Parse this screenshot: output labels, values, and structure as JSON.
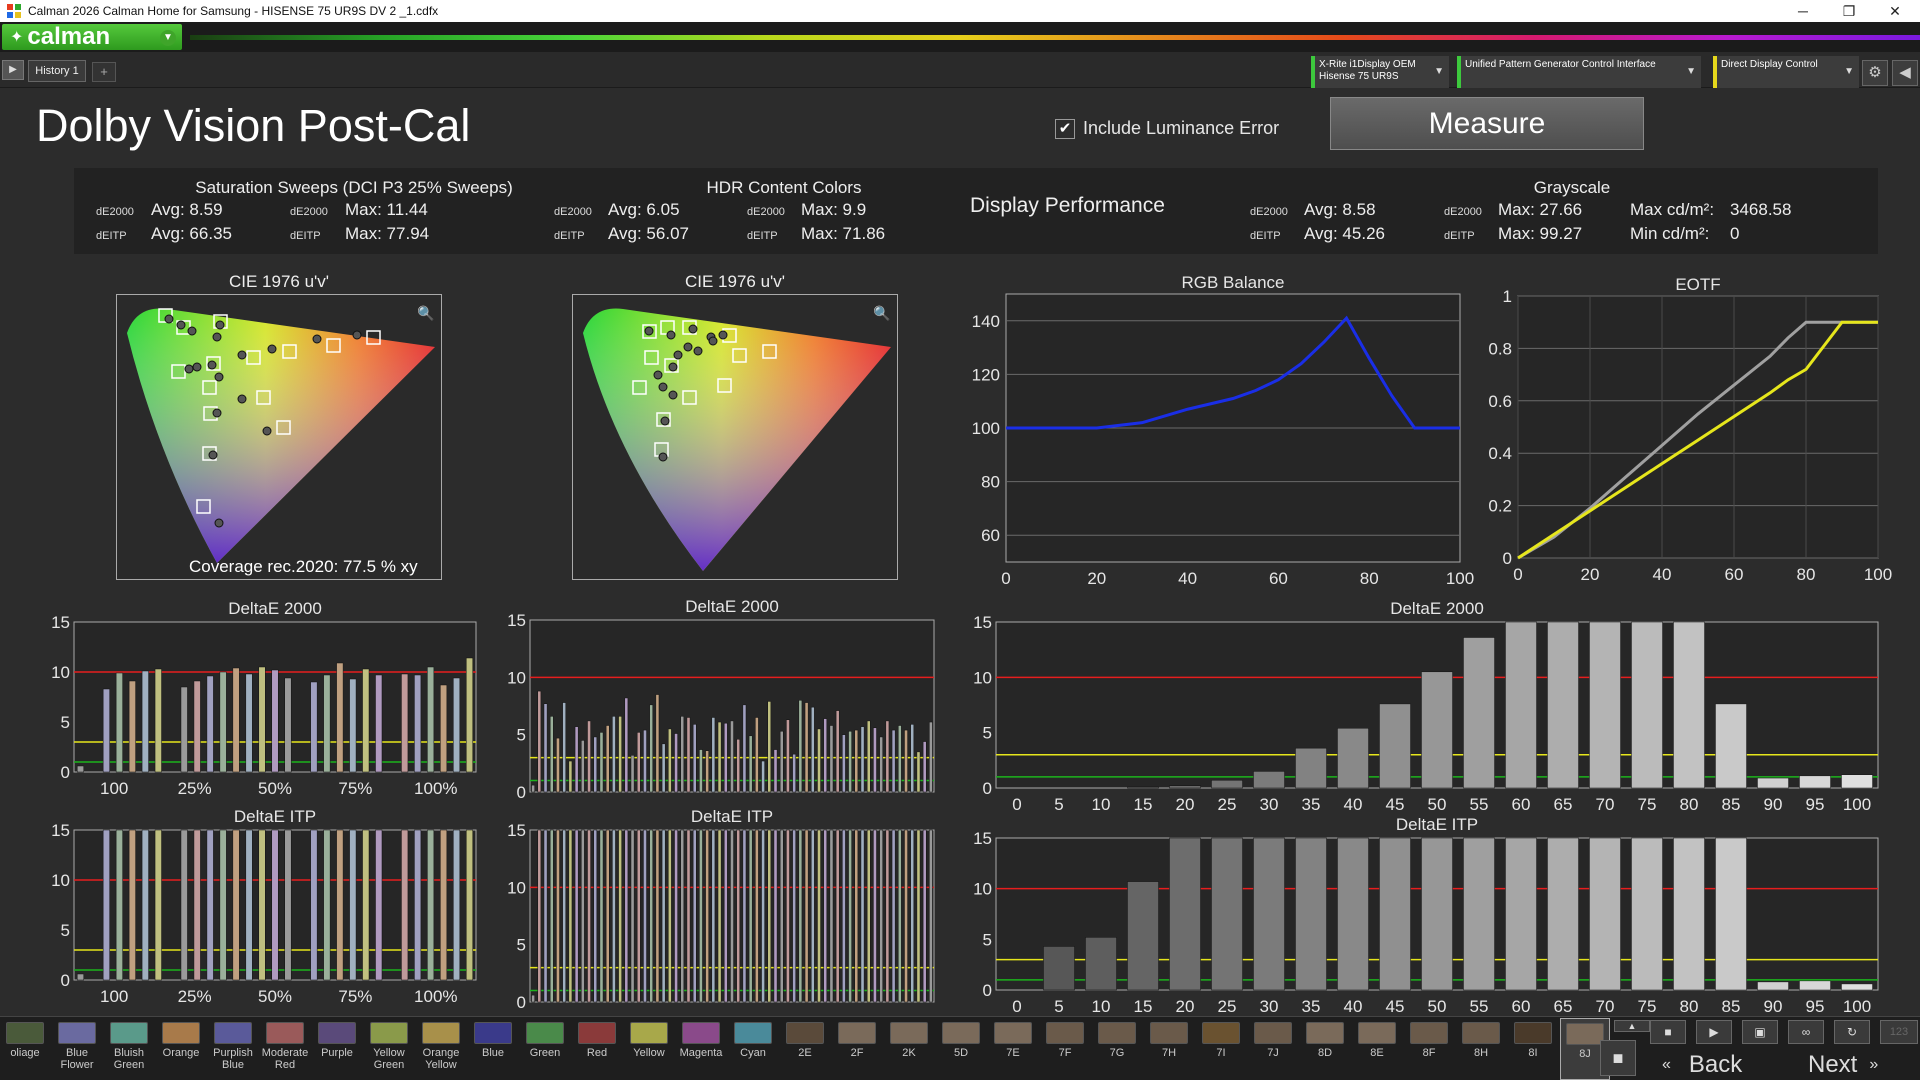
{
  "window": {
    "title": "Calman 2026 Calman Home for Samsung  - HISENSE 75 UR9S DV 2 _1.cdfx",
    "minimize": "─",
    "maximize": "❐",
    "close": "✕"
  },
  "logo": {
    "text": "calman"
  },
  "tabs": [
    {
      "label": "History 1"
    }
  ],
  "tab_add": "+",
  "devices": [
    {
      "line1": "X-Rite i1Display OEM",
      "line2": "Hisense 75 UR9S"
    },
    {
      "line1": "Unified Pattern Generator Control Interface",
      "line2": ""
    },
    {
      "line1": "Direct Display Control",
      "line2": ""
    }
  ],
  "page": {
    "title": "Dolby Vision Post-Cal"
  },
  "include_luminance": {
    "label": "Include Luminance Error",
    "checked": true
  },
  "measure_label": "Measure",
  "performance": {
    "heading": "Display Performance",
    "saturation": {
      "title": "Saturation Sweeps (DCI P3 25% Sweeps)",
      "de2000_avg": "Avg: 8.59",
      "de2000_max": "Max: 11.44",
      "deitp_avg": "Avg: 66.35",
      "deitp_max": "Max: 77.94"
    },
    "hdr": {
      "title": "HDR Content Colors",
      "de2000_avg": "Avg: 6.05",
      "de2000_max": "Max: 9.9",
      "deitp_avg": "Avg: 56.07",
      "deitp_max": "Max: 71.86"
    },
    "grayscale": {
      "title": "Grayscale",
      "de2000_avg": "Avg: 8.58",
      "de2000_max": "Max: 27.66",
      "deitp_avg": "Avg: 45.26",
      "deitp_max": "Max: 99.27",
      "max_cd": "Max cd/m²:",
      "max_cd_val": "3468.58",
      "min_cd": "Min cd/m²:",
      "min_cd_val": "0"
    },
    "label_de2000": "dE2000",
    "label_deitp": "dEITP"
  },
  "cie": {
    "title": "CIE 1976 u'v'",
    "coverage": "Coverage rec.2020:  77.5 % xy"
  },
  "chart_data": [
    {
      "type": "line",
      "title": "RGB Balance",
      "x": [
        0,
        10,
        20,
        30,
        40,
        50,
        55,
        60,
        65,
        70,
        75,
        80,
        85,
        90,
        95,
        100
      ],
      "series": [
        {
          "values": [
            100,
            100,
            100,
            102,
            107,
            111,
            114,
            118,
            124,
            132,
            141,
            126,
            112,
            100,
            100,
            100
          ],
          "color": "#1a2ee6"
        }
      ],
      "xticks": [
        "0",
        "20",
        "40",
        "60",
        "80",
        "100"
      ],
      "yticks": [
        "60",
        "80",
        "100",
        "120",
        "140"
      ],
      "xlim": [
        0,
        100
      ],
      "ylim": [
        50,
        150
      ]
    },
    {
      "type": "line",
      "title": "EOTF",
      "x": [
        0,
        0.1,
        0.2,
        0.3,
        0.4,
        0.5,
        0.6,
        0.7,
        0.75,
        0.8,
        0.9,
        1.0
      ],
      "series": [
        {
          "values": [
            0,
            0.08,
            0.19,
            0.31,
            0.43,
            0.55,
            0.66,
            0.77,
            0.84,
            0.9,
            0.9,
            0.9
          ],
          "color": "#a0a0a0"
        },
        {
          "values": [
            0,
            0.09,
            0.18,
            0.27,
            0.36,
            0.45,
            0.54,
            0.63,
            0.68,
            0.72,
            0.9,
            0.9
          ],
          "color": "#e6e61c"
        }
      ],
      "xticks": [
        "0",
        "20",
        "40",
        "60",
        "80",
        "100"
      ],
      "yticks": [
        "0",
        "0.2",
        "0.4",
        "0.6",
        "0.8",
        "1"
      ],
      "xlim": [
        0,
        100
      ],
      "ylim": [
        0,
        1
      ]
    },
    {
      "type": "bar",
      "title": "DeltaE 2000",
      "categories": [
        "100",
        "25%",
        "50%",
        "75%",
        "100%"
      ],
      "values": [
        0.6,
        0.0,
        8.3,
        9.9,
        9.1,
        10.1,
        10.3,
        0,
        8.5,
        9.1,
        9.6,
        10.0,
        10.4,
        9.8,
        10.5,
        10.2,
        9.4,
        0,
        9.0,
        9.7,
        10.9,
        9.3,
        10.3,
        9.7,
        0,
        9.8,
        9.7,
        10.5,
        8.7,
        9.4,
        11.4
      ],
      "ylim": [
        0,
        15
      ],
      "yticks": [
        "0",
        "5",
        "10",
        "15"
      ]
    },
    {
      "type": "bar",
      "title": "DeltaE 2000",
      "values": [
        0.6,
        8.8,
        7.7,
        6.6,
        4.7,
        7.8,
        2.7,
        5.7,
        4.5,
        6.2,
        4.8,
        5.2,
        5.8,
        6.6,
        6.6,
        8.2,
        3.2,
        5.2,
        5.4,
        7.6,
        8.5,
        4.2,
        5.5,
        5.1,
        6.6,
        6.5,
        5.9,
        3.7,
        3.6,
        6.5,
        6.1,
        6.0,
        6.2,
        4.6,
        7.6,
        4.9,
        6.5,
        2.7,
        7.9,
        3.7,
        5.3,
        6.3,
        3.3,
        8.0,
        7.8,
        7.4,
        5.5,
        6.4,
        5.8,
        7.1,
        5.0,
        5.3,
        5.4,
        5.7,
        6.2,
        5.6,
        4.8,
        6.2,
        5.4,
        5.8,
        5.4,
        5.9,
        3.5,
        4.4,
        6.1
      ],
      "ylim": [
        0,
        15
      ],
      "yticks": [
        "0",
        "5",
        "10",
        "15"
      ]
    },
    {
      "type": "bar",
      "title": "DeltaE 2000",
      "categories": [
        "0",
        "5",
        "10",
        "15",
        "20",
        "25",
        "30",
        "35",
        "40",
        "45",
        "50",
        "55",
        "60",
        "65",
        "70",
        "75",
        "80",
        "85",
        "90",
        "95",
        "100"
      ],
      "values": [
        0,
        0,
        0,
        0.1,
        0.2,
        0.7,
        1.5,
        3.6,
        5.4,
        7.6,
        10.5,
        13.6,
        27.66,
        22,
        20,
        18,
        16,
        7.6,
        0.9,
        1.1,
        1.2
      ],
      "ylim": [
        0,
        15
      ],
      "yticks": [
        "0",
        "5",
        "10",
        "15"
      ]
    },
    {
      "type": "bar",
      "title": "DeltaE ITP",
      "categories": [
        "100",
        "25%",
        "50%",
        "75%",
        "100%"
      ],
      "values": [
        0.6,
        0,
        60,
        62,
        64,
        66,
        68,
        0,
        60,
        62,
        65,
        66,
        68,
        70,
        72,
        64,
        60,
        0,
        62,
        66,
        70,
        72,
        74,
        66,
        0,
        62,
        64,
        70,
        74,
        72,
        77.94
      ],
      "ylim": [
        0,
        15
      ],
      "yticks": [
        "0",
        "5",
        "10",
        "15"
      ]
    },
    {
      "type": "bar",
      "title": "DeltaE ITP",
      "values": [
        0.6,
        56,
        56,
        56,
        56,
        56,
        56,
        56,
        56,
        56,
        56,
        56,
        56,
        56,
        56,
        56,
        56,
        56,
        56,
        56,
        56,
        56,
        56,
        56,
        56,
        56,
        56,
        56,
        56,
        56,
        56,
        56,
        56,
        56,
        56,
        56,
        56,
        56,
        56,
        56,
        56,
        56,
        56,
        56,
        56,
        56,
        56,
        56,
        56,
        56,
        56,
        56,
        56,
        56,
        56,
        56,
        56,
        56,
        56,
        56,
        56,
        56,
        56,
        56,
        56
      ],
      "ylim": [
        0,
        15
      ],
      "yticks": [
        "0",
        "5",
        "10",
        "15"
      ]
    },
    {
      "type": "bar",
      "title": "DeltaE ITP",
      "categories": [
        "0",
        "5",
        "10",
        "15",
        "20",
        "25",
        "30",
        "35",
        "40",
        "45",
        "50",
        "55",
        "60",
        "65",
        "70",
        "75",
        "80",
        "85",
        "90",
        "95",
        "100"
      ],
      "values": [
        0,
        4.3,
        5.2,
        10.7,
        30,
        40,
        50,
        60,
        70,
        80,
        90,
        95,
        99.27,
        95,
        90,
        85,
        80,
        80,
        0.8,
        0.9,
        0.6
      ],
      "ylim": [
        0,
        15
      ],
      "yticks": [
        "0",
        "5",
        "10",
        "15"
      ]
    }
  ],
  "swatches": [
    {
      "label": "oliage",
      "color": "#4a5a3a"
    },
    {
      "label": "Blue Flower",
      "color": "#6a6aa0"
    },
    {
      "label": "Bluish Green",
      "color": "#5a9a8a"
    },
    {
      "label": "Orange",
      "color": "#a87a4a"
    },
    {
      "label": "Purplish Blue",
      "color": "#5a5a9a"
    },
    {
      "label": "Moderate Red",
      "color": "#9a5a5a"
    },
    {
      "label": "Purple",
      "color": "#5a4a7a"
    },
    {
      "label": "Yellow Green",
      "color": "#8a9a4a"
    },
    {
      "label": "Orange Yellow",
      "color": "#a8904a"
    },
    {
      "label": "Blue",
      "color": "#3a3a8a"
    },
    {
      "label": "Green",
      "color": "#4a8a4a"
    },
    {
      "label": "Red",
      "color": "#8a3a3a"
    },
    {
      "label": "Yellow",
      "color": "#a8a84a"
    },
    {
      "label": "Magenta",
      "color": "#8a4a8a"
    },
    {
      "label": "Cyan",
      "color": "#4a8a9a"
    },
    {
      "label": "2E",
      "color": "#5a4a3a"
    },
    {
      "label": "2F",
      "color": "#7a6a5a"
    },
    {
      "label": "2K",
      "color": "#7a6a5a"
    },
    {
      "label": "5D",
      "color": "#7a6a5a"
    },
    {
      "label": "7E",
      "color": "#7a6a5a"
    },
    {
      "label": "7F",
      "color": "#6a5a4a"
    },
    {
      "label": "7G",
      "color": "#6a5a4a"
    },
    {
      "label": "7H",
      "color": "#6a5a4a"
    },
    {
      "label": "7I",
      "color": "#6a5230"
    },
    {
      "label": "7J",
      "color": "#6a5a4a"
    },
    {
      "label": "8D",
      "color": "#7a6a5a"
    },
    {
      "label": "8E",
      "color": "#7a6a5a"
    },
    {
      "label": "8F",
      "color": "#6a5a4a"
    },
    {
      "label": "8H",
      "color": "#6a5a4a"
    },
    {
      "label": "8I",
      "color": "#4a3a2a"
    },
    {
      "label": "8J",
      "color": "#7a6a5a"
    }
  ],
  "controls": {
    "back": "Back",
    "next": "Next",
    "counter": "123"
  }
}
